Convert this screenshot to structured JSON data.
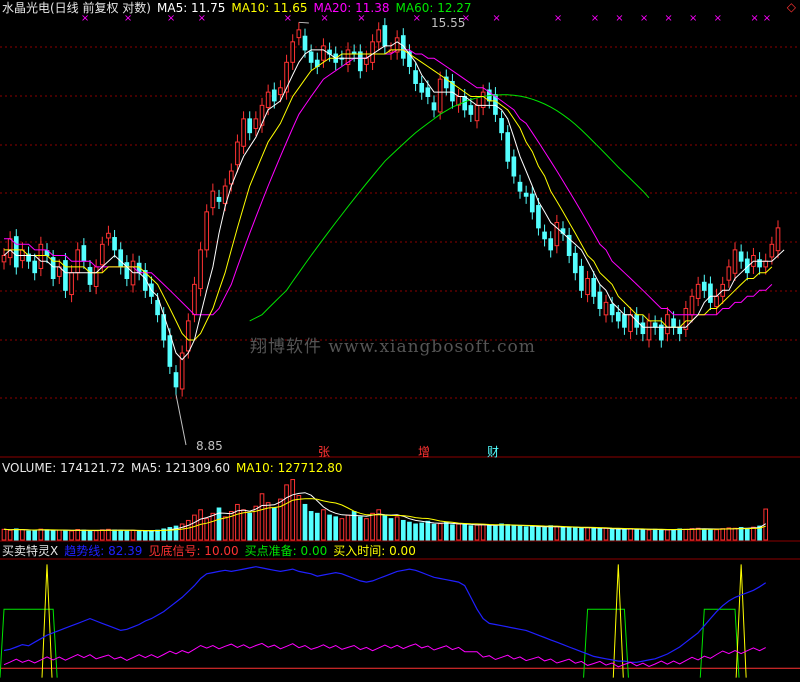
{
  "colors": {
    "up": "#ff3232",
    "down": "#54ffff",
    "ma5": "#ffffff",
    "ma10": "#ffff00",
    "ma20": "#ff00ff",
    "ma60": "#00e600",
    "grid": "#8b0000",
    "trend": "#2020ff"
  },
  "header": {
    "title": "水晶光电(日线 前复权 对数)",
    "ma5_label": "MA5: 11.75",
    "ma10_label": "MA10: 11.65",
    "ma20_label": "MA20: 11.38",
    "ma60_label": "MA60: 12.27"
  },
  "volume_header": {
    "volume_label": "VOLUME: 174121.72",
    "ma5_label": "MA5: 121309.60",
    "ma10_label": "MA10: 127712.80"
  },
  "indicator_header": {
    "name": "买卖特灵X",
    "trend_label": "趋势线: 82.39",
    "bottom_label": "见底信号: 10.00",
    "buy_ready_label": "买点准备: 0.00",
    "buy_time_label": "买入时间: 0.00"
  },
  "annotations": {
    "high_price": "15.55",
    "low_price": "8.85",
    "signal_zhang": "张",
    "signal_zeng": "增",
    "signal_cai": "财",
    "top_marker": "×",
    "corner_icon": "◇"
  },
  "watermark": "翔博软件 www.xiangbosoft.com",
  "chart_data": {
    "type": "candlestick",
    "scale": "log",
    "ylim": [
      8.5,
      16.2
    ],
    "price_close": [
      11.2,
      11.5,
      11.0,
      11.3,
      11.1,
      10.9,
      11.4,
      11.2,
      10.8,
      11.0,
      10.6,
      10.9,
      11.3,
      11.1,
      10.7,
      11.0,
      11.4,
      11.6,
      11.3,
      11.0,
      10.8,
      11.1,
      10.9,
      10.6,
      10.5,
      10.2,
      9.8,
      9.4,
      9.1,
      9.6,
      10.1,
      10.7,
      11.3,
      12.0,
      12.4,
      12.2,
      12.5,
      12.8,
      13.4,
      13.9,
      13.6,
      13.9,
      14.2,
      14.5,
      14.3,
      14.6,
      15.2,
      15.7,
      16.0,
      15.5,
      15.2,
      15.1,
      15.6,
      15.4,
      15.2,
      15.3,
      15.5,
      15.4,
      15.0,
      15.3,
      15.7,
      16.0,
      15.6,
      15.5,
      15.8,
      15.3,
      15.1,
      14.7,
      14.5,
      14.4,
      14.1,
      14.8,
      14.6,
      14.3,
      14.4,
      14.1,
      14.0,
      14.2,
      14.5,
      14.3,
      14.0,
      13.6,
      13.0,
      12.7,
      12.4,
      12.3,
      12.0,
      11.7,
      11.5,
      11.3,
      11.8,
      11.6,
      11.2,
      10.9,
      10.6,
      10.8,
      10.5,
      10.3,
      10.4,
      10.2,
      10.1,
      10.0,
      10.2,
      10.0,
      9.9,
      10.1,
      10.0,
      9.8,
      10.2,
      10.0,
      9.9,
      10.3,
      10.5,
      10.7,
      10.6,
      10.4,
      10.5,
      10.7,
      11.0,
      11.3,
      11.1,
      10.9,
      11.2,
      11.0,
      11.1,
      11.4,
      11.7
    ],
    "ma5": [
      11.2,
      11.3,
      11.2,
      11.2,
      11.2,
      11.2,
      11.1,
      11.1,
      11.0,
      11.0,
      10.9,
      10.9,
      10.9,
      10.9,
      10.9,
      10.9,
      11.0,
      11.1,
      11.2,
      11.1,
      11.0,
      10.9,
      10.9,
      10.8,
      10.6,
      10.5,
      10.2,
      9.9,
      9.6,
      9.5,
      9.6,
      9.8,
      10.2,
      10.6,
      11.0,
      11.6,
      12.1,
      12.5,
      12.8,
      13.1,
      13.3,
      13.5,
      13.8,
      14.1,
      14.2,
      14.3,
      14.6,
      14.9,
      15.2,
      15.4,
      15.5,
      15.5,
      15.5,
      15.4,
      15.3,
      15.3,
      15.3,
      15.3,
      15.3,
      15.3,
      15.4,
      15.5,
      15.6,
      15.6,
      15.7,
      15.6,
      15.4,
      15.2,
      14.9,
      14.7,
      14.5,
      14.5,
      14.5,
      14.5,
      14.4,
      14.4,
      14.3,
      14.2,
      14.2,
      14.2,
      14.2,
      14.1,
      13.9,
      13.5,
      13.1,
      12.8,
      12.5,
      12.2,
      12.0,
      11.8,
      11.7,
      11.6,
      11.5,
      11.4,
      11.3,
      11.1,
      10.9,
      10.7,
      10.6,
      10.4,
      10.3,
      10.2,
      10.2,
      10.1,
      10.0,
      10.0,
      10.0,
      10.0,
      10.0,
      10.0,
      10.0,
      10.0,
      10.1,
      10.2,
      10.4,
      10.5,
      10.5,
      10.6,
      10.6,
      10.8,
      10.9,
      11.0,
      11.1,
      11.1,
      11.1,
      11.1,
      11.2,
      11.3
    ],
    "ma10": [
      11.3,
      11.3,
      11.3,
      11.3,
      11.2,
      11.2,
      11.2,
      11.2,
      11.1,
      11.1,
      11.0,
      11.0,
      11.0,
      11.0,
      10.9,
      10.9,
      10.9,
      11.0,
      11.0,
      11.0,
      11.0,
      11.0,
      11.0,
      10.9,
      10.8,
      10.7,
      10.5,
      10.3,
      10.1,
      9.9,
      9.8,
      9.8,
      9.9,
      10.1,
      10.3,
      10.6,
      10.9,
      11.3,
      11.7,
      12.1,
      12.5,
      12.8,
      13.1,
      13.4,
      13.6,
      13.8,
      14.1,
      14.4,
      14.6,
      14.8,
      15.0,
      15.1,
      15.2,
      15.3,
      15.3,
      15.4,
      15.4,
      15.4,
      15.4,
      15.4,
      15.4,
      15.4,
      15.4,
      15.5,
      15.5,
      15.5,
      15.4,
      15.3,
      15.2,
      15.1,
      15.0,
      14.9,
      14.8,
      14.7,
      14.6,
      14.5,
      14.4,
      14.4,
      14.4,
      14.3,
      14.3,
      14.2,
      14.1,
      13.9,
      13.7,
      13.4,
      13.2,
      12.9,
      12.7,
      12.4,
      12.2,
      12.0,
      11.8,
      11.6,
      11.4,
      11.2,
      11.1,
      10.9,
      10.8,
      10.7,
      10.5,
      10.4,
      10.3,
      10.2,
      10.2,
      10.1,
      10.1,
      10.1,
      10.0,
      10.0,
      10.0,
      10.1,
      10.1,
      10.2,
      10.2,
      10.3,
      10.3,
      10.4,
      10.5,
      10.6,
      10.7,
      10.8,
      10.8,
      10.9,
      10.9,
      11.0
    ],
    "ma20": [
      11.5,
      11.5,
      11.4,
      11.4,
      11.4,
      11.3,
      11.3,
      11.3,
      11.2,
      11.2,
      11.2,
      11.1,
      11.1,
      11.1,
      11.1,
      11.0,
      11.0,
      11.0,
      11.0,
      11.0,
      11.0,
      11.0,
      10.9,
      10.9,
      10.9,
      10.8,
      10.7,
      10.6,
      10.5,
      10.4,
      10.3,
      10.2,
      10.2,
      10.2,
      10.2,
      10.3,
      10.5,
      10.7,
      11.0,
      11.3,
      11.6,
      11.9,
      12.2,
      12.5,
      12.8,
      13.1,
      13.4,
      13.7,
      14.0,
      14.2,
      14.4,
      14.6,
      14.8,
      14.9,
      15.0,
      15.1,
      15.2,
      15.3,
      15.3,
      15.3,
      15.4,
      15.4,
      15.4,
      15.4,
      15.5,
      15.5,
      15.5,
      15.4,
      15.4,
      15.3,
      15.3,
      15.2,
      15.1,
      15.0,
      14.9,
      14.8,
      14.7,
      14.6,
      14.6,
      14.5,
      14.4,
      14.3,
      14.2,
      14.1,
      13.9,
      13.8,
      13.6,
      13.4,
      13.2,
      13.0,
      12.8,
      12.6,
      12.4,
      12.2,
      12.0,
      11.8,
      11.6,
      11.4,
      11.3,
      11.1,
      11.0,
      10.9,
      10.8,
      10.7,
      10.6,
      10.5,
      10.4,
      10.3,
      10.3,
      10.2,
      10.2,
      10.2,
      10.2,
      10.2,
      10.2,
      10.2,
      10.2,
      10.3,
      10.3,
      10.4,
      10.4,
      10.5,
      10.5,
      10.6,
      10.6,
      10.7
    ],
    "ma60_start_index": 40,
    "ma60": [
      10.1,
      10.15,
      10.2,
      10.3,
      10.4,
      10.5,
      10.6,
      10.75,
      10.9,
      11.05,
      11.2,
      11.35,
      11.5,
      11.65,
      11.8,
      11.95,
      12.1,
      12.25,
      12.4,
      12.55,
      12.7,
      12.85,
      13.0,
      13.12,
      13.24,
      13.36,
      13.48,
      13.6,
      13.7,
      13.8,
      13.9,
      14.0,
      14.08,
      14.16,
      14.22,
      14.28,
      14.33,
      14.37,
      14.4,
      14.42,
      14.43,
      14.44,
      14.44,
      14.43,
      14.41,
      14.38,
      14.34,
      14.29,
      14.23,
      14.16,
      14.08,
      13.99,
      13.89,
      13.78,
      13.66,
      13.53,
      13.4,
      13.27,
      13.14,
      13.01,
      12.88,
      12.76,
      12.64,
      12.52,
      12.4,
      12.27
    ],
    "volume_ylim": [
      0,
      360000
    ],
    "volume": [
      60000,
      55000,
      62000,
      58000,
      50000,
      54000,
      61000,
      57000,
      52000,
      56000,
      53000,
      51000,
      59000,
      55000,
      50000,
      52000,
      57000,
      60000,
      56000,
      53000,
      50000,
      54000,
      52000,
      49000,
      51000,
      55000,
      62000,
      70000,
      78000,
      90000,
      110000,
      140000,
      170000,
      120000,
      150000,
      180000,
      130000,
      160000,
      200000,
      170000,
      150000,
      190000,
      260000,
      210000,
      180000,
      230000,
      310000,
      340000,
      250000,
      200000,
      160000,
      150000,
      170000,
      140000,
      130000,
      120000,
      140000,
      160000,
      130000,
      120000,
      150000,
      170000,
      140000,
      120000,
      130000,
      110000,
      100000,
      90000,
      95000,
      105000,
      88000,
      92000,
      98000,
      85000,
      90000,
      86000,
      80000,
      84000,
      88000,
      82000,
      78000,
      90000,
      86000,
      80000,
      78000,
      74000,
      76000,
      72000,
      70000,
      80000,
      74000,
      70000,
      68000,
      72000,
      66000,
      70000,
      64000,
      62000,
      66000,
      60000,
      58000,
      62000,
      64000,
      60000,
      58000,
      56000,
      60000,
      58000,
      57000,
      59000,
      62000,
      60000,
      64000,
      66000,
      62000,
      60000,
      58000,
      64000,
      68000,
      66000,
      70000,
      64000,
      72000,
      78000,
      174121
    ],
    "trend_ylim": [
      0,
      100
    ],
    "trend": [
      25,
      26,
      28,
      30,
      29,
      32,
      35,
      38,
      40,
      42,
      44,
      46,
      48,
      50,
      52,
      50,
      48,
      46,
      44,
      42,
      43,
      45,
      47,
      50,
      52,
      55,
      58,
      62,
      66,
      70,
      75,
      80,
      86,
      90,
      91,
      92,
      93,
      92,
      93,
      94,
      95,
      96,
      95,
      94,
      93,
      92,
      93,
      94,
      92,
      91,
      90,
      88,
      89,
      90,
      91,
      90,
      88,
      86,
      84,
      83,
      84,
      86,
      88,
      90,
      92,
      93,
      94,
      93,
      91,
      89,
      87,
      86,
      85,
      84,
      83,
      80,
      70,
      60,
      52,
      48,
      47,
      46,
      45,
      44,
      43,
      42,
      40,
      38,
      36,
      34,
      32,
      30,
      28,
      26,
      24,
      22,
      20,
      19,
      18,
      17,
      16,
      16,
      15,
      15,
      16,
      17,
      18,
      20,
      22,
      25,
      28,
      32,
      36,
      40,
      46,
      52,
      58,
      63,
      67,
      70,
      72,
      74,
      76,
      79,
      82.39
    ],
    "bottom_signal_spikes": [
      7,
      100,
      120
    ],
    "buy_ready_windows": [
      [
        0,
        8
      ],
      [
        95,
        101
      ],
      [
        114,
        119
      ]
    ],
    "signal_baseline": 10.0
  }
}
